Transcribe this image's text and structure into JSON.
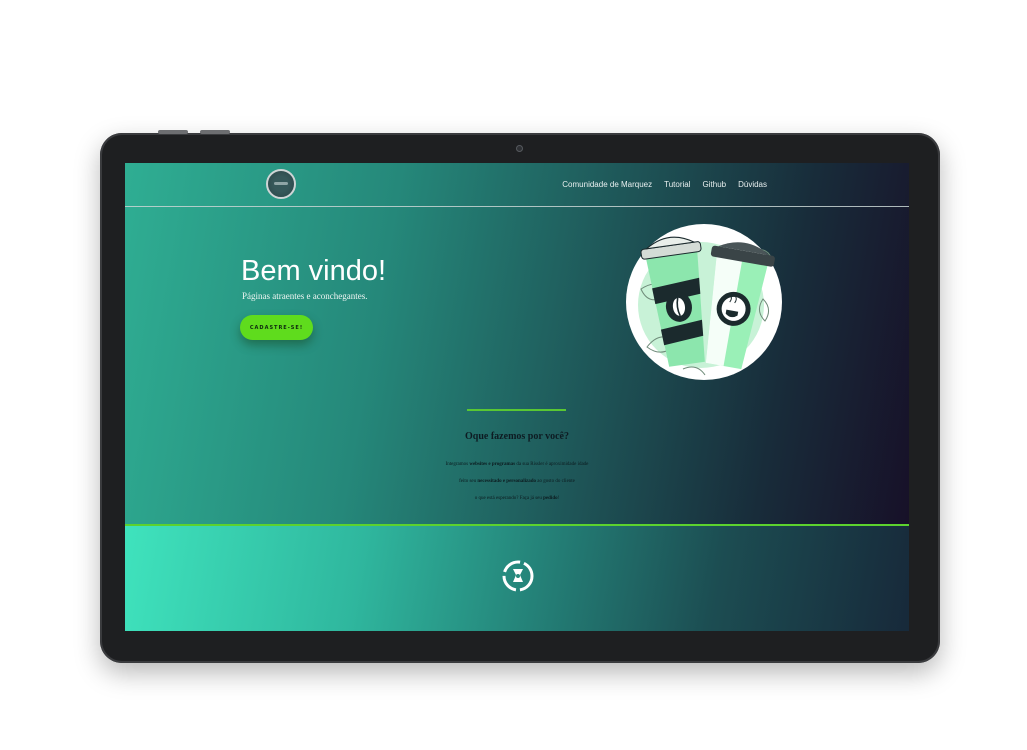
{
  "nav": {
    "links": [
      "Comunidade de Marquez",
      "Tutorial",
      "Github",
      "Dúvidas"
    ]
  },
  "hero": {
    "title": "Bem vindo!",
    "subtitle": "Páginas atraentes e aconchegantes.",
    "cta_label": "CADASTRE-SE!"
  },
  "section": {
    "title": "Oque fazemos por você?",
    "line1": {
      "a": "Integramos ",
      "b": "websites e programas",
      "c": " da sua Rissler é aproximidade idade"
    },
    "line2": {
      "a": "feito seu ",
      "b": "necessitado e personalizado",
      "c": " ao gosto do cliente"
    },
    "line3": {
      "a": "o que está esperando? Faça já seu ",
      "b": "pedido",
      "c": "!"
    }
  },
  "icons": [
    "logo-icon",
    "coffee-cups-illustration",
    "footer-logo-icon"
  ],
  "colors": {
    "accent_green": "#5fdc1d",
    "rule_green": "#5cd22e",
    "teal_dark": "#1f5c5c",
    "purple_dark": "#170d26",
    "footer_teal": "#3fe3bd"
  }
}
